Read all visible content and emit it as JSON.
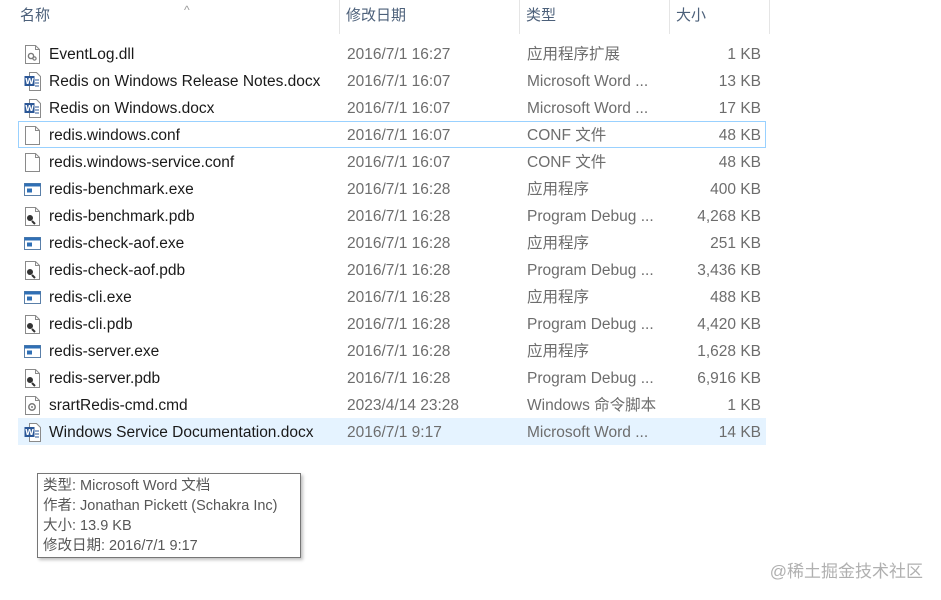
{
  "header": {
    "col_name": "名称",
    "col_date": "修改日期",
    "col_type": "类型",
    "col_size": "大小",
    "sort_indicator": "^"
  },
  "files": [
    {
      "name": "EventLog.dll",
      "date": "2016/7/1 16:27",
      "type": "应用程序扩展",
      "size": "1 KB",
      "icon": "dll-icon"
    },
    {
      "name": "Redis on Windows Release Notes.docx",
      "date": "2016/7/1 16:07",
      "type": "Microsoft Word ...",
      "size": "13 KB",
      "icon": "word-doc-icon"
    },
    {
      "name": "Redis on Windows.docx",
      "date": "2016/7/1 16:07",
      "type": "Microsoft Word ...",
      "size": "17 KB",
      "icon": "word-doc-icon"
    },
    {
      "name": "redis.windows.conf",
      "date": "2016/7/1 16:07",
      "type": "CONF 文件",
      "size": "48 KB",
      "icon": "blank-file-icon"
    },
    {
      "name": "redis.windows-service.conf",
      "date": "2016/7/1 16:07",
      "type": "CONF 文件",
      "size": "48 KB",
      "icon": "blank-file-icon"
    },
    {
      "name": "redis-benchmark.exe",
      "date": "2016/7/1 16:28",
      "type": "应用程序",
      "size": "400 KB",
      "icon": "exe-icon"
    },
    {
      "name": "redis-benchmark.pdb",
      "date": "2016/7/1 16:28",
      "type": "Program Debug ...",
      "size": "4,268 KB",
      "icon": "pdb-icon"
    },
    {
      "name": "redis-check-aof.exe",
      "date": "2016/7/1 16:28",
      "type": "应用程序",
      "size": "251 KB",
      "icon": "exe-icon"
    },
    {
      "name": "redis-check-aof.pdb",
      "date": "2016/7/1 16:28",
      "type": "Program Debug ...",
      "size": "3,436 KB",
      "icon": "pdb-icon"
    },
    {
      "name": "redis-cli.exe",
      "date": "2016/7/1 16:28",
      "type": "应用程序",
      "size": "488 KB",
      "icon": "exe-icon"
    },
    {
      "name": "redis-cli.pdb",
      "date": "2016/7/1 16:28",
      "type": "Program Debug ...",
      "size": "4,420 KB",
      "icon": "pdb-icon"
    },
    {
      "name": "redis-server.exe",
      "date": "2016/7/1 16:28",
      "type": "应用程序",
      "size": "1,628 KB",
      "icon": "exe-icon"
    },
    {
      "name": "redis-server.pdb",
      "date": "2016/7/1 16:28",
      "type": "Program Debug ...",
      "size": "6,916 KB",
      "icon": "pdb-icon"
    },
    {
      "name": "srartRedis-cmd.cmd",
      "date": "2023/4/14 23:28",
      "type": "Windows 命令脚本",
      "size": "1 KB",
      "icon": "cmd-icon"
    },
    {
      "name": "Windows Service Documentation.docx",
      "date": "2016/7/1 9:17",
      "type": "Microsoft Word ...",
      "size": "14 KB",
      "icon": "word-doc-icon"
    }
  ],
  "focused_index": 3,
  "selected_index": 14,
  "tooltip": {
    "type_line": "类型: Microsoft Word 文档",
    "author_line": "作者: Jonathan Pickett (Schakra Inc)",
    "size_line": "大小: 13.9 KB",
    "date_line": "修改日期: 2016/7/1 9:17"
  },
  "watermark": "@稀土掘金技术社区",
  "colors": {
    "header_text": "#4c607a",
    "selection_bg": "#e5f3ff",
    "focus_border": "#99d1ff",
    "word_blue": "#2b5797"
  }
}
